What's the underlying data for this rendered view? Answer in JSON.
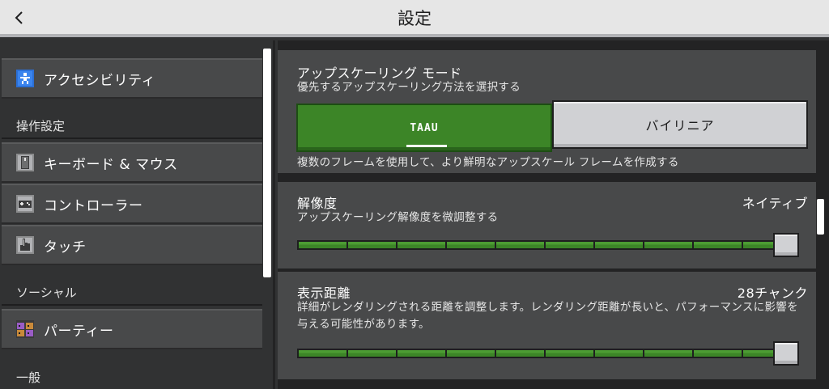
{
  "header": {
    "title": "設定"
  },
  "sidebar": {
    "items": [
      {
        "label": "アクセシビリティ"
      },
      {
        "label": "キーボード & マウス"
      },
      {
        "label": "コントローラー"
      },
      {
        "label": "タッチ"
      },
      {
        "label": "パーティー"
      }
    ],
    "headers": [
      "操作設定",
      "ソーシャル",
      "一般"
    ]
  },
  "main": {
    "upscaling": {
      "title": "アップスケーリング モード",
      "subtitle": "優先するアップスケーリング方法を選択する",
      "options": [
        "TAAU",
        "バイリニア"
      ],
      "selected": "TAAU",
      "description": "複数のフレームを使用して、より鮮明なアップスケール フレームを作成する"
    },
    "resolution": {
      "title": "解像度",
      "value": "ネイティブ",
      "description": "アップスケーリング解像度を微調整する",
      "level": 1.0
    },
    "render_distance": {
      "title": "表示距離",
      "value": "28チャンク",
      "description": "詳細がレンダリングされる距離を調整します。レンダリング距離が長いと、パフォーマンスに影響を与える可能性があります。",
      "level": 1.0
    }
  },
  "colors": {
    "accent_green": "#3c8527",
    "panel": "#48494a",
    "background": "#313233"
  }
}
